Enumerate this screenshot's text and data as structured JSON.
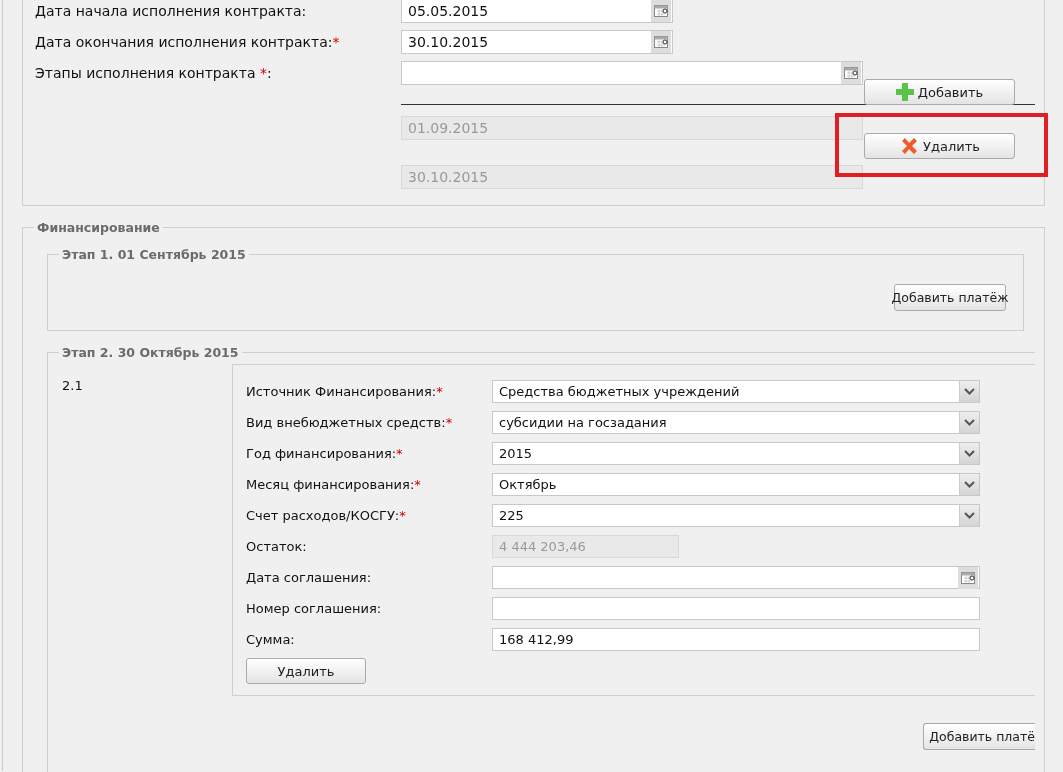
{
  "contract_dates": [
    {
      "label": "Дата начала исполнения контракта:",
      "value": "05.05.2015"
    },
    {
      "label": "Дата окончания исполнения контракта:",
      "required_mark": "*",
      "value": "30.10.2015"
    }
  ],
  "stages_field": {
    "label": "Этапы исполнения контракта ",
    "required_mark": "*",
    "label_end": ":",
    "add_button": "Добавить"
  },
  "stage_dates": [
    {
      "value": "01.09.2015",
      "disabled": true
    },
    {
      "value": "30.10.2015",
      "disabled": true
    }
  ],
  "delete_stage_button": {
    "label": "Удалить",
    "highlighted": true
  },
  "financing": {
    "legend": "Финансирование",
    "stages": [
      {
        "legend": "Этап 1. 01 Сентябрь 2015",
        "add_button": "Добавить платёж"
      },
      {
        "legend": "Этап 2. 30 Октябрь 2015",
        "payments": [
          {
            "number": "2.1",
            "fields": [
              {
                "kind": "select",
                "label": "Источник Финансирования:",
                "required_mark": "*",
                "value": "Средства бюджетных учреждений",
                "disabled": false
              },
              {
                "kind": "select",
                "label": "Вид внебюджетных средств:",
                "required_mark": "*",
                "value": "субсидии на госзадания",
                "disabled": false
              },
              {
                "kind": "select",
                "label": "Год финансирования:",
                "required_mark": "*",
                "value": "2015",
                "disabled": false
              },
              {
                "kind": "select",
                "label": "Месяц финансирования:",
                "required_mark": "*",
                "value": "Октябрь",
                "disabled": false
              },
              {
                "kind": "select",
                "label": "Счет расходов/КОСГУ:",
                "required_mark": "*",
                "value": "225",
                "disabled": false
              },
              {
                "kind": "text",
                "label": "Остаток:",
                "value": "4 444 203,46",
                "disabled": true
              },
              {
                "kind": "date",
                "label": "Дата соглашения:",
                "disabled": false
              },
              {
                "kind": "text",
                "label": "Номер соглашения:",
                "disabled": false
              },
              {
                "kind": "text",
                "label": "Сумма:",
                "value": "168 412,99",
                "disabled": false
              }
            ],
            "delete_button": "Удалить"
          }
        ],
        "add_button": "Добавить платё"
      }
    ]
  }
}
